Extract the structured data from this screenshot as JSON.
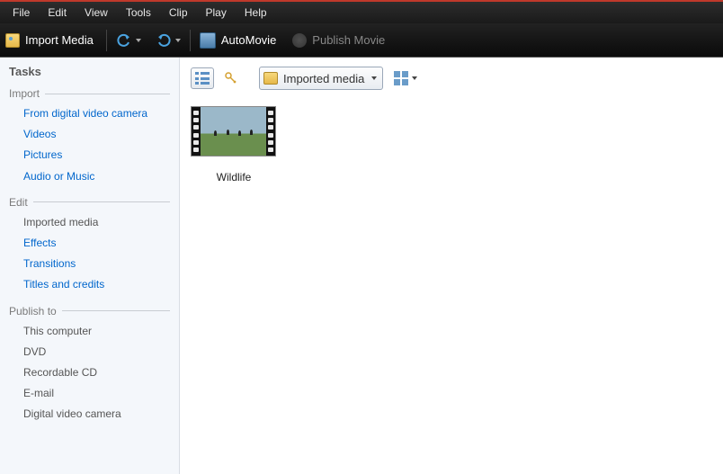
{
  "menubar": [
    "File",
    "Edit",
    "View",
    "Tools",
    "Clip",
    "Play",
    "Help"
  ],
  "toolbar": {
    "import_media": "Import Media",
    "automovie": "AutoMovie",
    "publish_movie": "Publish Movie"
  },
  "sidebar": {
    "title": "Tasks",
    "groups": [
      {
        "header": "Import",
        "items": [
          {
            "label": "From digital video camera",
            "link": true
          },
          {
            "label": "Videos",
            "link": true
          },
          {
            "label": "Pictures",
            "link": true
          },
          {
            "label": "Audio or Music",
            "link": true
          }
        ]
      },
      {
        "header": "Edit",
        "items": [
          {
            "label": "Imported media",
            "link": false
          },
          {
            "label": "Effects",
            "link": true
          },
          {
            "label": "Transitions",
            "link": true
          },
          {
            "label": "Titles and credits",
            "link": true
          }
        ]
      },
      {
        "header": "Publish to",
        "items": [
          {
            "label": "This computer",
            "link": false
          },
          {
            "label": "DVD",
            "link": false
          },
          {
            "label": "Recordable CD",
            "link": false
          },
          {
            "label": "E-mail",
            "link": false
          },
          {
            "label": "Digital video camera",
            "link": false
          }
        ]
      }
    ]
  },
  "content": {
    "dropdown_label": "Imported media",
    "clips": [
      {
        "name": "Wildlife"
      }
    ]
  }
}
